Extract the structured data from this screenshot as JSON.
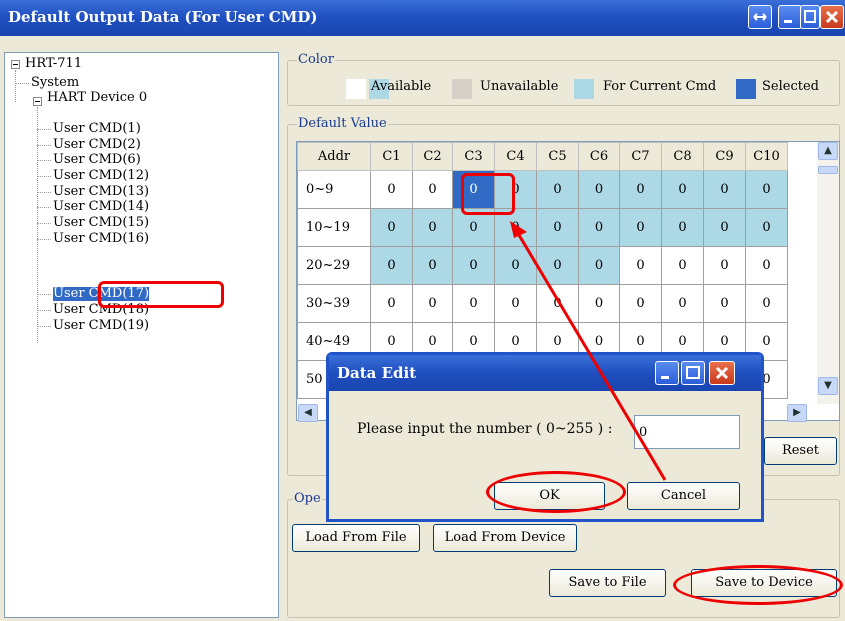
{
  "window": {
    "title": "Default Output Data (For User CMD)"
  },
  "tree": {
    "root": "HRT-711",
    "system": "System",
    "device": "HART Device 0",
    "items": [
      "User CMD(1)",
      "User CMD(2)",
      "User CMD(6)",
      "User CMD(12)",
      "User CMD(13)",
      "User CMD(14)",
      "User CMD(15)",
      "User CMD(16)",
      "User CMD(17)",
      "User CMD(18)",
      "User CMD(19)"
    ],
    "selected": "User CMD(17)"
  },
  "color_legend": {
    "label": "Color",
    "available": "Available",
    "unavailable": "Unavailable",
    "current": "For Current Cmd",
    "selected": "Selected",
    "colors": {
      "white": "#ffffff",
      "available": "#add8e6",
      "unavailable": "#d4d0c8",
      "current": "#add8e6",
      "selected": "#316ac5"
    }
  },
  "default_value": {
    "label": "Default Value",
    "columns": [
      "Addr",
      "C1",
      "C2",
      "C3",
      "C4",
      "C5",
      "C6",
      "C7",
      "C8",
      "C9",
      "C10"
    ],
    "rows": [
      {
        "addr": "0~9",
        "vals": [
          "0",
          "0",
          "0",
          "0",
          "0",
          "0",
          "0",
          "0",
          "0",
          "0"
        ],
        "state": [
          "w",
          "w",
          "s",
          "a",
          "a",
          "a",
          "a",
          "a",
          "a",
          "a"
        ]
      },
      {
        "addr": "10~19",
        "vals": [
          "0",
          "0",
          "0",
          "0",
          "0",
          "0",
          "0",
          "0",
          "0",
          "0"
        ],
        "state": [
          "a",
          "a",
          "a",
          "a",
          "a",
          "a",
          "a",
          "a",
          "a",
          "a"
        ]
      },
      {
        "addr": "20~29",
        "vals": [
          "0",
          "0",
          "0",
          "0",
          "0",
          "0",
          "0",
          "0",
          "0",
          "0"
        ],
        "state": [
          "a",
          "a",
          "a",
          "a",
          "a",
          "a",
          "w",
          "w",
          "w",
          "w"
        ]
      },
      {
        "addr": "30~39",
        "vals": [
          "0",
          "0",
          "0",
          "0",
          "0",
          "0",
          "0",
          "0",
          "0",
          "0"
        ],
        "state": [
          "w",
          "w",
          "w",
          "w",
          "w",
          "w",
          "w",
          "w",
          "w",
          "w"
        ]
      },
      {
        "addr": "40~49",
        "vals": [
          "0",
          "0",
          "0",
          "0",
          "0",
          "0",
          "0",
          "0",
          "0",
          "0"
        ],
        "state": [
          "w",
          "w",
          "w",
          "w",
          "w",
          "w",
          "w",
          "w",
          "w",
          "w"
        ]
      },
      {
        "addr": "50",
        "vals": [
          "",
          "",
          "",
          "",
          "",
          "",
          "",
          "",
          "",
          "0"
        ],
        "state": [
          "w",
          "w",
          "w",
          "w",
          "w",
          "w",
          "w",
          "w",
          "w",
          "w"
        ]
      }
    ],
    "reset": "Reset"
  },
  "operation": {
    "label": "Ope",
    "load_file": "Load From File",
    "load_device": "Load From Device",
    "save_file": "Save to File",
    "save_device": "Save to Device"
  },
  "dialog": {
    "title": "Data Edit",
    "prompt": "Please input the number ( 0~255 ) :",
    "value": "0",
    "ok": "OK",
    "cancel": "Cancel"
  }
}
